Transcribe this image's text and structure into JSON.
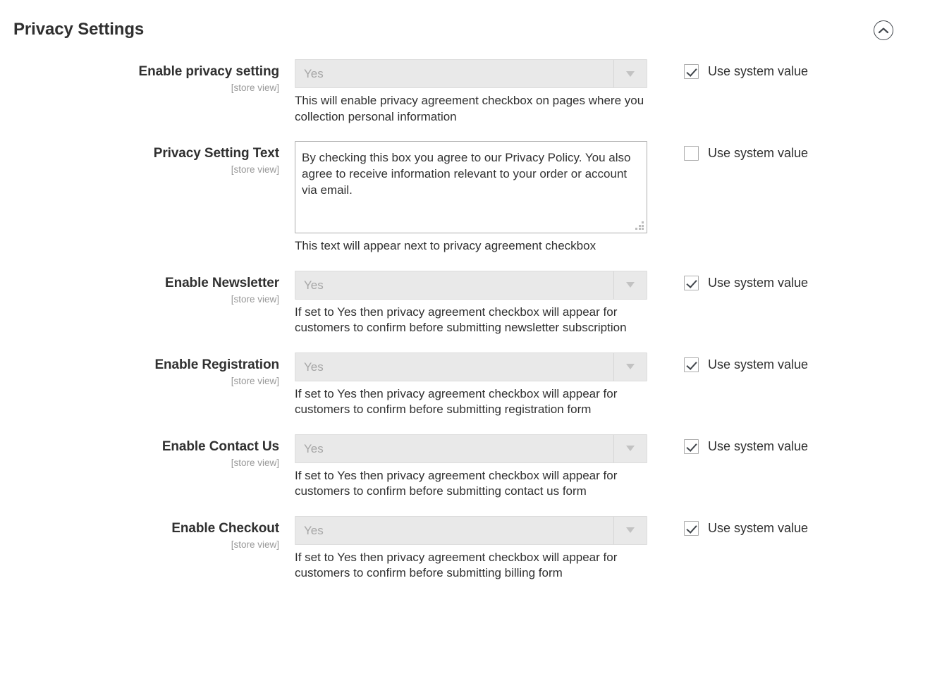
{
  "section": {
    "title": "Privacy Settings",
    "collapse_icon": "chevron-up-icon"
  },
  "common": {
    "scope_label": "[store view]",
    "use_system_value_label": "Use system value",
    "select_arrow_icon": "chevron-down-icon",
    "resize_handle_icon": "resize-grip-icon"
  },
  "colors": {
    "text": "#303030",
    "muted": "#999999",
    "disabled_field_bg": "#e9e9e9",
    "disabled_field_text": "#a6a6a6",
    "border": "#adadad"
  },
  "fields": [
    {
      "id": "enable-privacy-setting",
      "label": "Enable privacy setting",
      "scope": "[store view]",
      "type": "select",
      "value": "Yes",
      "note": "This will enable privacy agreement checkbox on pages where you collection personal information",
      "use_system_value": true
    },
    {
      "id": "privacy-setting-text",
      "label": "Privacy Setting Text",
      "scope": "[store view]",
      "type": "textarea",
      "value": "By checking this box you agree to our Privacy Policy. You also agree to receive information relevant to your order or account via email.",
      "note": "This text will appear next to privacy agreement checkbox",
      "use_system_value": false
    },
    {
      "id": "enable-newsletter",
      "label": "Enable Newsletter",
      "scope": "[store view]",
      "type": "select",
      "value": "Yes",
      "note": "If set to Yes then privacy agreement checkbox will appear for customers to confirm before submitting newsletter subscription",
      "use_system_value": true
    },
    {
      "id": "enable-registration",
      "label": "Enable Registration",
      "scope": "[store view]",
      "type": "select",
      "value": "Yes",
      "note": "If set to Yes then privacy agreement checkbox will appear for customers to confirm before submitting registration form",
      "use_system_value": true
    },
    {
      "id": "enable-contact-us",
      "label": "Enable Contact Us",
      "scope": "[store view]",
      "type": "select",
      "value": "Yes",
      "note": "If set to Yes then privacy agreement checkbox will appear for customers to confirm before submitting contact us form",
      "use_system_value": true
    },
    {
      "id": "enable-checkout",
      "label": "Enable Checkout",
      "scope": "[store view]",
      "type": "select",
      "value": "Yes",
      "note": "If set to Yes then privacy agreement checkbox will appear for customers to confirm before submitting billing form",
      "use_system_value": true
    }
  ]
}
